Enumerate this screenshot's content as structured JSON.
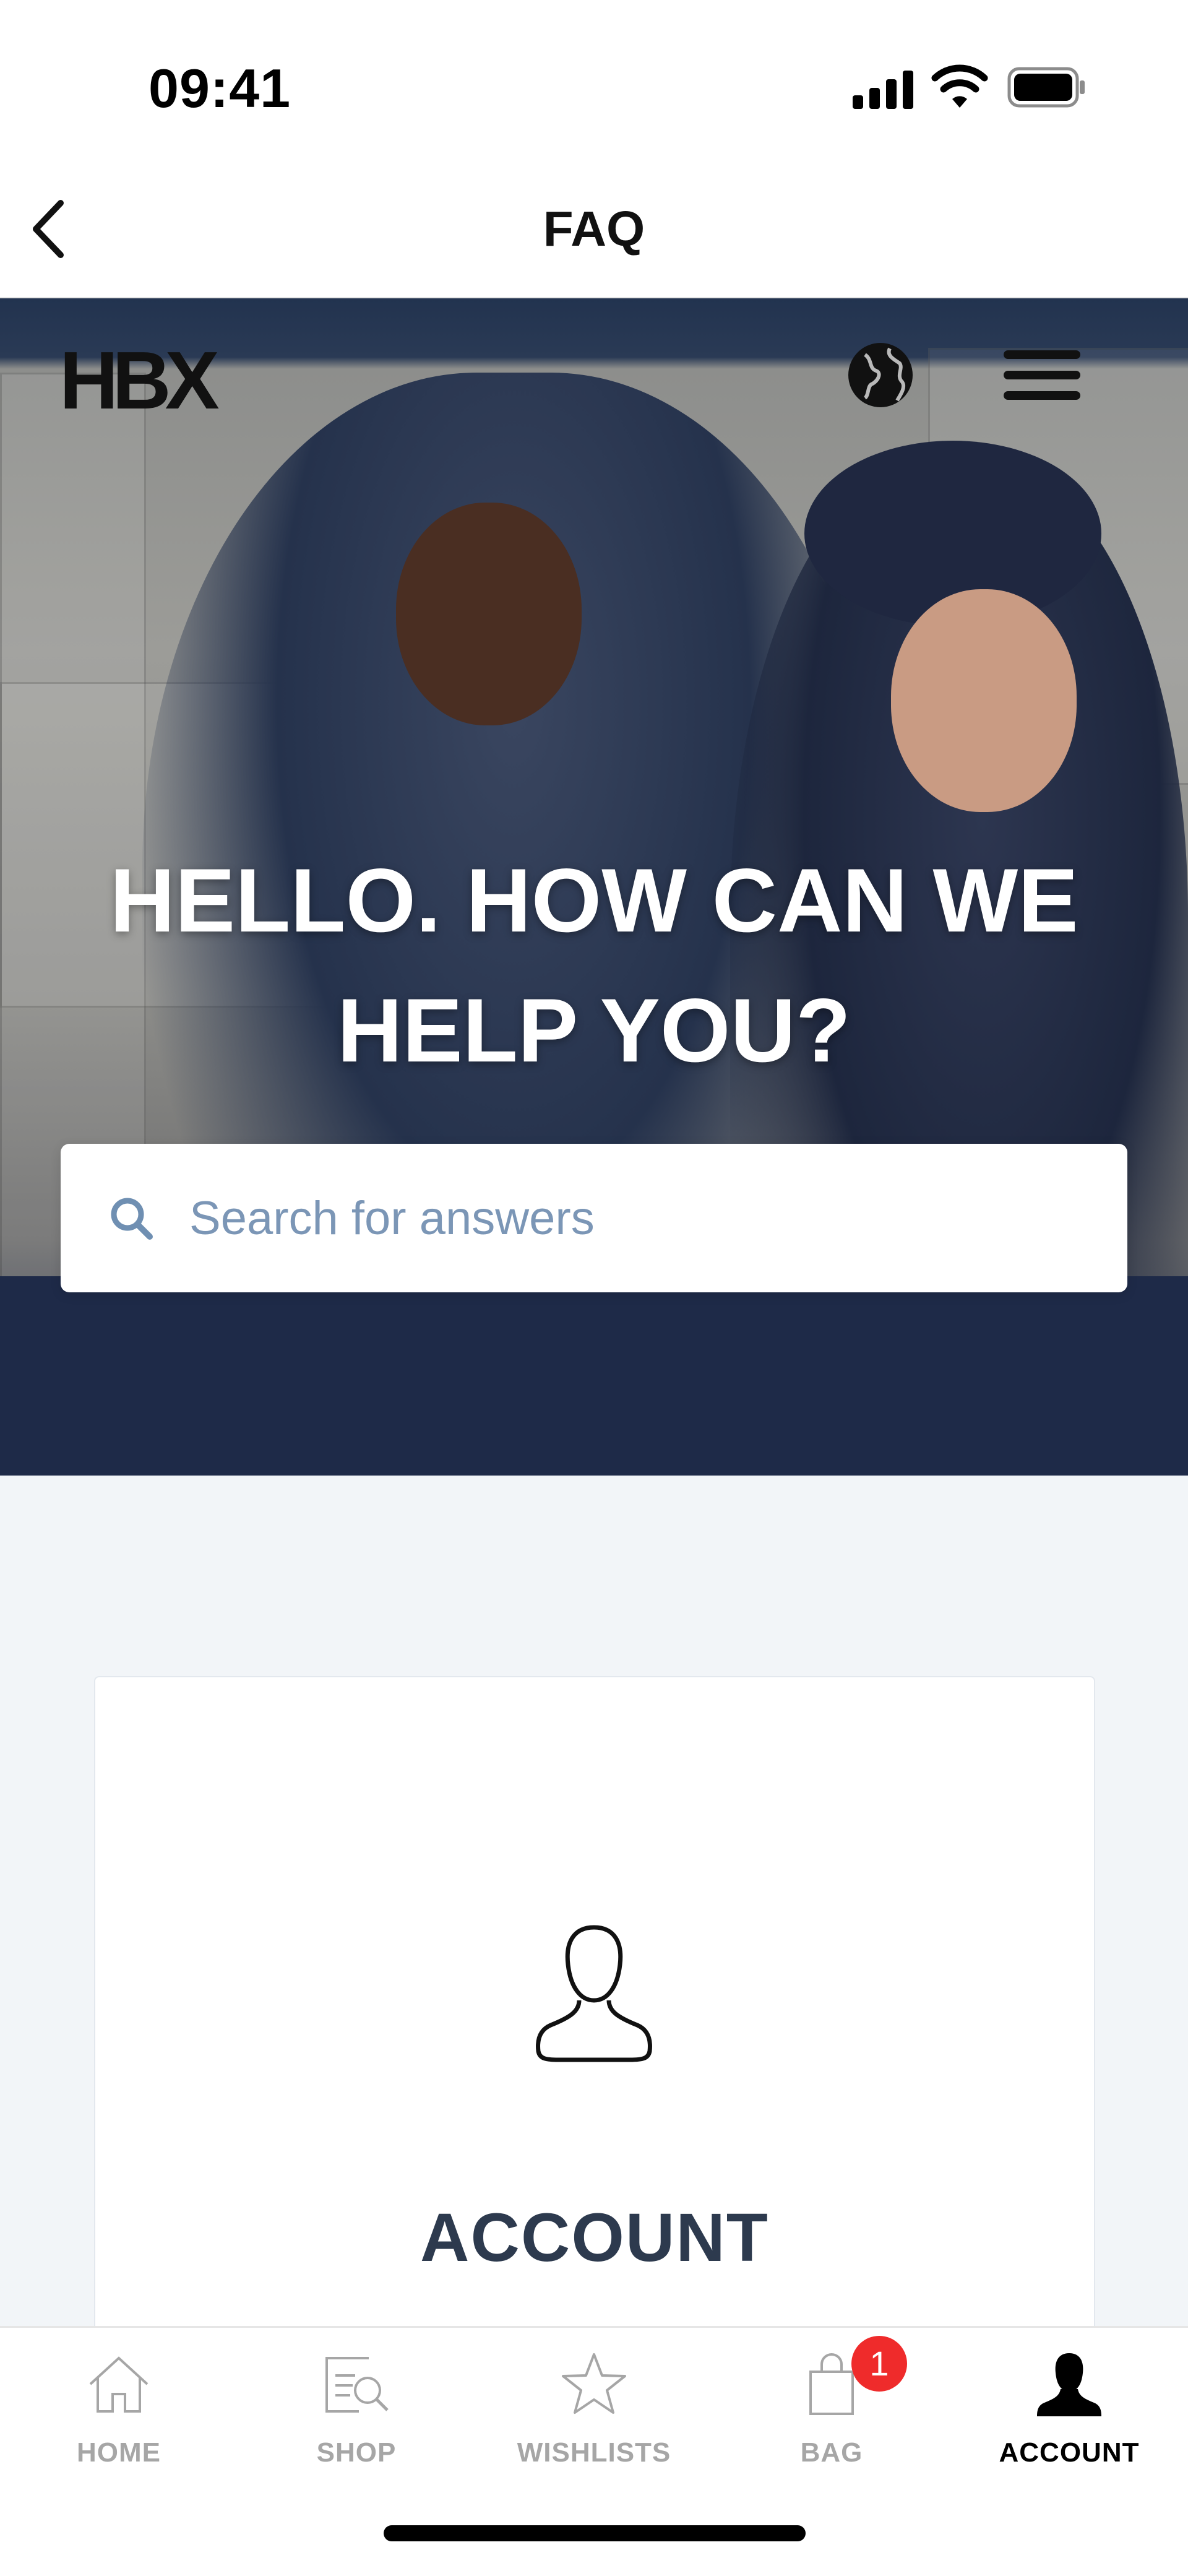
{
  "status_bar": {
    "time": "09:41"
  },
  "header": {
    "title": "FAQ"
  },
  "hero": {
    "logo": "HBX",
    "heading": "HELLO. HOW CAN WE HELP YOU?",
    "search": {
      "placeholder": "Search for answers",
      "value": ""
    }
  },
  "card": {
    "title": "ACCOUNT",
    "icon": "user-outline-icon"
  },
  "tabs": [
    {
      "label": "HOME",
      "icon": "home-icon",
      "active": false
    },
    {
      "label": "SHOP",
      "icon": "shop-search-icon",
      "active": false
    },
    {
      "label": "WISHLISTS",
      "icon": "star-icon",
      "active": false
    },
    {
      "label": "BAG",
      "icon": "bag-icon",
      "active": false,
      "badge": "1"
    },
    {
      "label": "ACCOUNT",
      "icon": "account-icon",
      "active": true
    }
  ],
  "colors": {
    "badge": "#ef2b2b",
    "placeholder": "#7b96b6",
    "card_title": "#2d3a4e",
    "content_bg": "#f2f5f8"
  }
}
